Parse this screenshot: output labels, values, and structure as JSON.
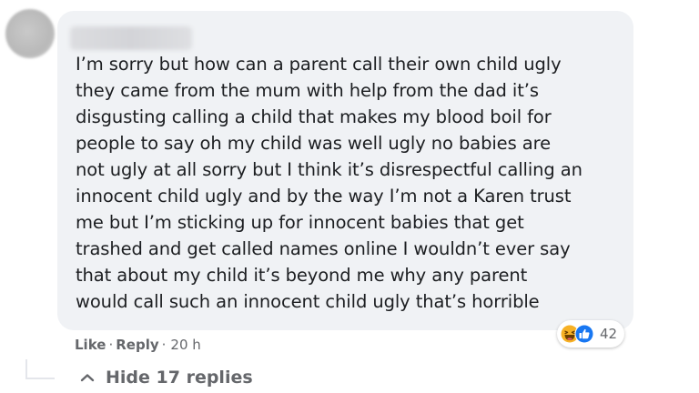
{
  "comment": {
    "text": "I’m sorry but how can a parent call their own child ugly\nthey came from the mum with help from the dad it’s\ndisgusting calling a child that makes my blood boil for\npeople to say oh my child was well ugly no babies are\nnot ugly at all sorry but I think it’s disrespectful calling an\ninnocent child ugly and by the way I’m not a Karen trust\nme but I’m sticking up for innocent babies that get\ntrashed and get called names online I wouldn’t ever say\nthat about my child it’s beyond me why any parent\nwould call such an innocent child ugly that’s horrible"
  },
  "reactions": {
    "icons": [
      "haha-icon",
      "like-icon"
    ],
    "count": "42"
  },
  "actions": {
    "like_label": "Like",
    "separator": "·",
    "reply_label": "Reply",
    "time": "20 h"
  },
  "replies": {
    "label": "Hide 17 replies",
    "icon": "chevron-up-icon"
  },
  "colors": {
    "bubble_bg": "#f0f2f5",
    "text": "#1c1e21",
    "secondary": "#65676b",
    "haha": "#f7b125",
    "like": "#1877f2"
  }
}
